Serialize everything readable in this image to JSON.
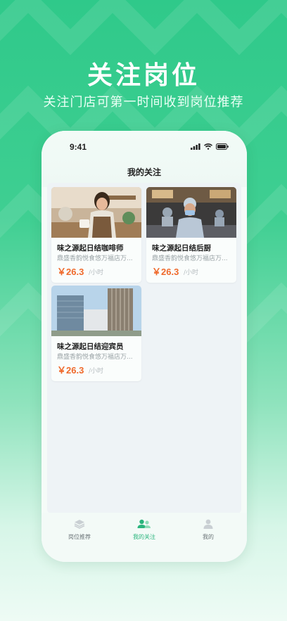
{
  "hero": {
    "title": "关注岗位",
    "subtitle": "关注门店可第一时间收到岗位推荐"
  },
  "status_bar": {
    "time": "9:41"
  },
  "page": {
    "title": "我的关注"
  },
  "jobs": [
    {
      "name": "味之源起日结咖啡师",
      "store": "鼎盛香韵悦食悠万福店万...",
      "price": "￥26.3",
      "unit": "/小时",
      "image": "barista-photo"
    },
    {
      "name": "味之源起日结后厨",
      "store": "鼎盛香韵悦食悠万福店万...",
      "price": "￥26.3",
      "unit": "/小时",
      "image": "kitchen-chef-photo"
    },
    {
      "name": "味之源起日结迎宾员",
      "store": "鼎盛香韵悦食悠万福店万...",
      "price": "￥26.3",
      "unit": "/小时",
      "image": "office-building-photo"
    }
  ],
  "tabs": [
    {
      "label": "岗位推荐",
      "icon": "layers-icon",
      "active": false
    },
    {
      "label": "我的关注",
      "icon": "people-icon",
      "active": true
    },
    {
      "label": "我的",
      "icon": "person-icon",
      "active": false
    }
  ],
  "colors": {
    "brand": "#2fc98a",
    "price": "#ef6a2c",
    "active_tab": "#2ab57d"
  }
}
